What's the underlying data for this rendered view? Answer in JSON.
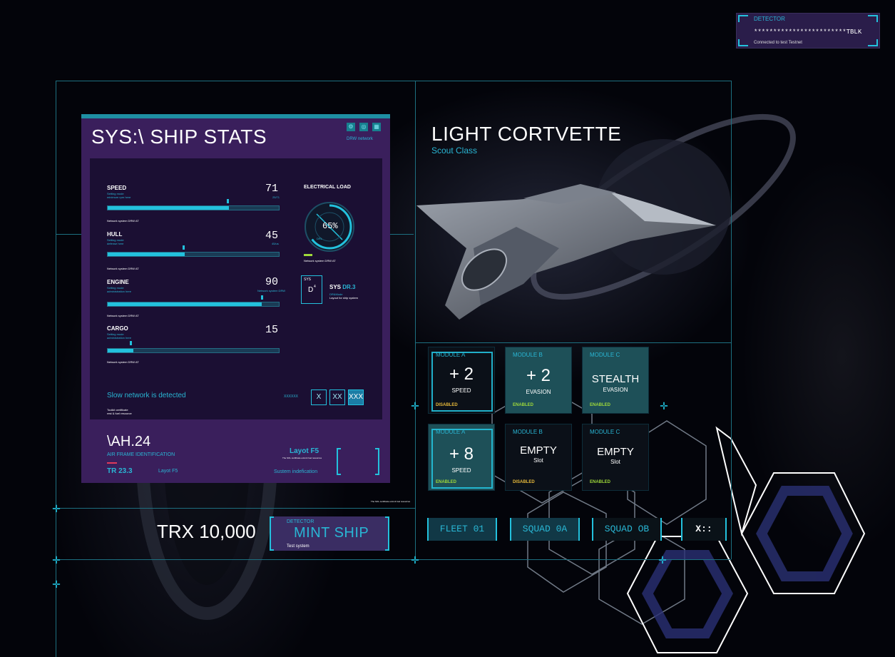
{
  "detector": {
    "label": "DETECTOR",
    "address": "************************TBLK",
    "connection": "Connected to test Testnet"
  },
  "stats_panel": {
    "title": "SYS:\\ SHIP STATS",
    "network_label": "DRW network",
    "stats": [
      {
        "name": "SPEED",
        "value": "71",
        "unit": "25/71",
        "sub1": "Setting mode",
        "sub2": "minimum rpm here",
        "progress": 0.71,
        "note": "Network system DRW AT"
      },
      {
        "name": "HULL",
        "value": "45",
        "unit": "45/us",
        "sub1": "Setting mode",
        "sub2": "defense here",
        "progress": 0.45,
        "note": "Network system DRW AT"
      },
      {
        "name": "ENGINE",
        "value": "90",
        "unit": "Network system DRW",
        "sub1": "Setting mode",
        "sub2": "administration here",
        "progress": 0.9,
        "note": "Network system DRW AT"
      },
      {
        "name": "CARGO",
        "value": "15",
        "unit": "",
        "sub1": "Setting mode",
        "sub2": "administration here",
        "progress": 0.15,
        "note": "Network system DRW AT"
      }
    ],
    "electrical": {
      "label": "ELECTRICAL LOAD",
      "value": "65%",
      "percent": 65,
      "small": "DRL",
      "note": "Network system DRW AT"
    },
    "sys_card": {
      "head": "SYS",
      "glyph": "D",
      "super": "4",
      "name": "SYS",
      "code": "DR.3",
      "line1": "DR&Mode",
      "line2": "Layout for ship system"
    },
    "slow_network": "Slow network is detected",
    "small_buttons": {
      "code": "XXXXXX",
      "b1": "X",
      "b2": "XX",
      "b3": "XXX"
    },
    "footer_note1": "Toolkit certificate",
    "footer_note2": "rest & fuel resource"
  },
  "airframe": {
    "code": "\\AH.24",
    "label": "AIR FRAME IDENTIFICATION",
    "tr": "TR 23.3",
    "layout_small": "Layot F5",
    "layout_big": "Layot F5",
    "layout_note": "The SOL certificate exist & fuel resources",
    "system_id": "Sustem indefication",
    "bottom_note": "The SOL certificate exist & fuel resources"
  },
  "ship": {
    "name": "LIGHT CORTVETTE",
    "class": "Scout Class"
  },
  "modules": [
    {
      "name": "MODULE A",
      "value": "+ 2",
      "stat": "SPEED",
      "status": "DISABLED",
      "state": "dis"
    },
    {
      "name": "MODULE B",
      "value": "+ 2",
      "stat": "EVASION",
      "status": "ENABLED",
      "state": "en"
    },
    {
      "name": "MODULE C",
      "value": "STEALTH",
      "stat": "EVASION",
      "status": "ENABLED",
      "state": "en"
    },
    {
      "name": "MODULE A",
      "value": "+ 8",
      "stat": "SPEED",
      "status": "ENABLED",
      "state": "en"
    },
    {
      "name": "MODULE B",
      "value": "EMPTY",
      "stat": "Slot",
      "status": "DISABLED",
      "state": "dis"
    },
    {
      "name": "MODULE C",
      "value": "EMPTY",
      "stat": "Slot",
      "status": "ENABLED",
      "state": "dis"
    }
  ],
  "fleet_buttons": [
    "FLEET 01",
    "SQUAD 0A",
    "SQUAD OB",
    "X::"
  ],
  "mint": {
    "price": "TRX 10,000",
    "label": "DETECTOR",
    "button": "MINT SHIP",
    "sub": "Test system"
  },
  "colors": {
    "accent": "#23c1dd",
    "panel": "#3a1f5c",
    "enabled": "#9fd93a",
    "disabled": "#e7b93a"
  }
}
